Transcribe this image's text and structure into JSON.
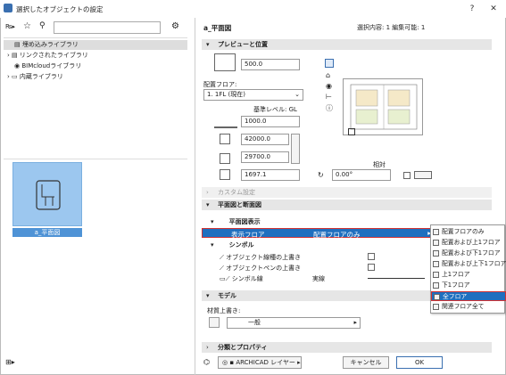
{
  "window": {
    "title": "選択したオブジェクトの設定",
    "help": "?",
    "close": "✕"
  },
  "library": {
    "items": [
      {
        "label": "埋め込みライブラリ",
        "icon": "embedded-library-icon",
        "selected": true
      },
      {
        "label": "リンクされたライブラリ",
        "icon": "linked-library-icon"
      },
      {
        "label": "BIMcloudライブラリ",
        "icon": "bimcloud-icon"
      },
      {
        "label": "内蔵ライブラリ",
        "icon": "builtin-library-icon"
      }
    ],
    "selected_object": "a_平面図"
  },
  "panel": {
    "object_name": "a_平面図",
    "selection_info": "選択内容: 1 編集可能: 1",
    "sections": {
      "preview": "プレビューと位置",
      "custom": "カスタム設定",
      "plan_section": "平面図と断面図",
      "model": "モデル",
      "classification": "分類とプロパティ"
    },
    "preview": {
      "value1": "500.0",
      "floor_label": "配置フロア:",
      "floor_value": "1. 1FL (現在)",
      "base_level": "基準レベル: GL",
      "elev": "1000.0",
      "width": "42000.0",
      "depth": "29700.0",
      "height": "1697.1",
      "relative_label": "相対",
      "angle": "0.00°"
    },
    "plan_display": {
      "group": "平面図表示",
      "show_floor_label": "表示フロア",
      "show_floor_value": "配置フロアのみ",
      "symbol_group": "シンボル",
      "override_line": "オブジェクト線種の上書き",
      "override_pen": "オブジェクトペンの上書き",
      "symbol_line": "シンボル線",
      "symbol_line_value": "実線"
    },
    "model": {
      "material_label": "材質上書き:",
      "material_value": "一般"
    },
    "footer": {
      "layer": "ARCHICAD レイヤー",
      "cancel": "キャンセル",
      "ok": "OK"
    }
  },
  "dropdown_menu": {
    "items": [
      "配置フロアのみ",
      "配置および上1フロア",
      "配置および下1フロア",
      "配置および上下1フロア",
      "上1フロア",
      "下1フロア",
      "全フロア",
      "関連フロア全て"
    ],
    "highlighted": "全フロア"
  }
}
